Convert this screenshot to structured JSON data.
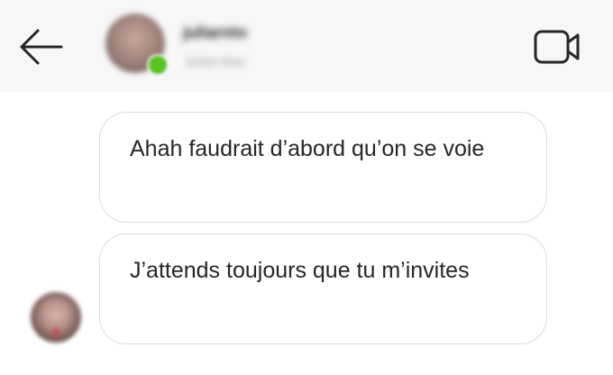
{
  "header": {
    "contact_name": "juliarnto",
    "contact_status": "Active Now",
    "back_icon": "arrow-left-icon",
    "video_icon": "video-camera-icon",
    "online_color": "#58c322"
  },
  "messages": [
    {
      "text": "Ahah faudrait d’abord qu’on se voie",
      "from": "contact"
    },
    {
      "text": "J’attends toujours que tu m’invites",
      "from": "contact"
    }
  ],
  "colors": {
    "header_bg": "#f7f7f7",
    "bubble_border": "#dcdcdc",
    "text": "#262626"
  }
}
